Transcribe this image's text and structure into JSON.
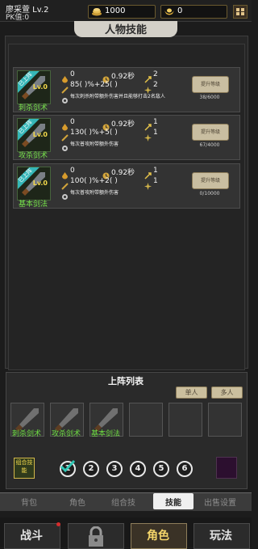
{
  "player": {
    "name": "廖采萱  Lv.2",
    "pk": "PK值:0"
  },
  "resources": {
    "gold": "1000",
    "ingot": "0"
  },
  "panel": {
    "title": "人物技能"
  },
  "skills": [
    {
      "badge": "已上阵",
      "level": "Lv.0",
      "name": "刺杀剑术",
      "mp": "0",
      "cooldown": "0.92秒",
      "count": "2",
      "damage": "85(  )%+25(  )",
      "targets": "2",
      "desc": "每次刺杀附带额外伤害并且能够打击2名敌人",
      "upgrade": "提升等级",
      "progress": "38/6000"
    },
    {
      "badge": "已上阵",
      "level": "Lv.0",
      "name": "攻杀剑术",
      "mp": "0",
      "cooldown": "0.92秒",
      "count": "1",
      "damage": "130(  )%+5(  )",
      "targets": "1",
      "desc": "每次普攻附带额外伤害",
      "upgrade": "提升等级",
      "progress": "67/4000"
    },
    {
      "badge": "已上阵",
      "level": "Lv.0",
      "name": "基本剑法",
      "mp": "0",
      "cooldown": "0.92秒",
      "count": "1",
      "damage": "100(  )%+2(  )",
      "targets": "1",
      "desc": "每次普攻附带额外伤害",
      "upgrade": "提升等级",
      "progress": "0/10000"
    }
  ],
  "lineup": {
    "title": "上阵列表",
    "single": "单人",
    "multi": "多人",
    "slots": [
      "刺杀剑术",
      "攻杀剑术",
      "基本剑法"
    ],
    "combo": "组合技能",
    "numbers": [
      "1",
      "2",
      "3",
      "4",
      "5",
      "6"
    ]
  },
  "tabs": [
    "背包",
    "角色",
    "组合技",
    "技能",
    "出售设置"
  ],
  "nav": [
    "战斗",
    "角色",
    "玩法"
  ],
  "colors": {
    "accent": "#35b6b7",
    "skill_name": "#6edc42",
    "gold": "#e2c58a"
  }
}
